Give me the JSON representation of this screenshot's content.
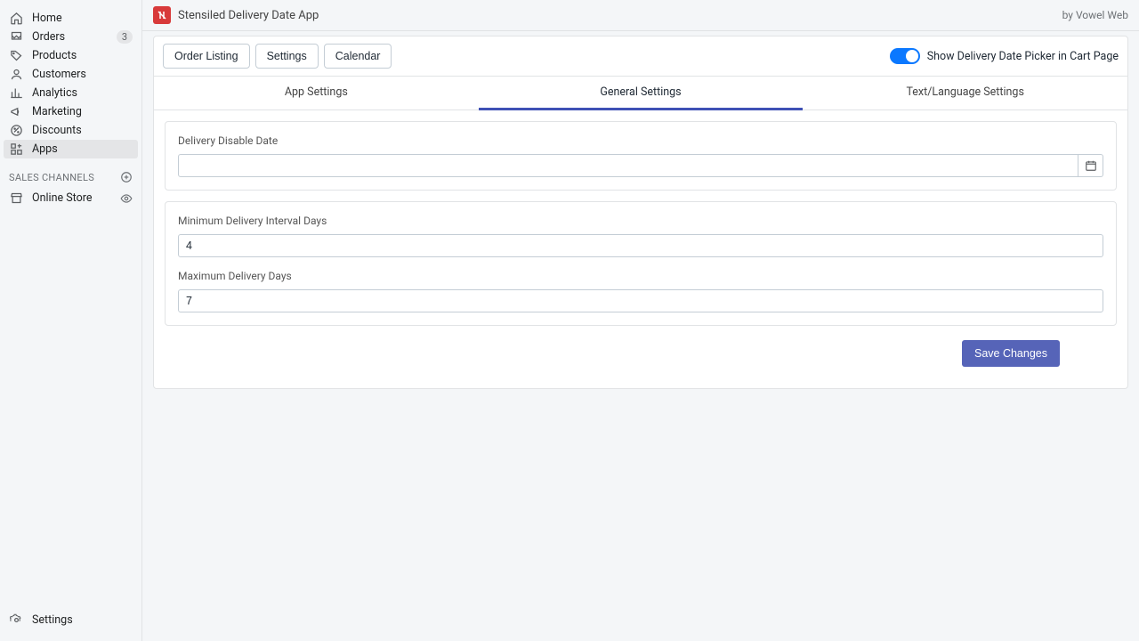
{
  "sidebar": {
    "items": [
      {
        "label": "Home"
      },
      {
        "label": "Orders",
        "badge": "3"
      },
      {
        "label": "Products"
      },
      {
        "label": "Customers"
      },
      {
        "label": "Analytics"
      },
      {
        "label": "Marketing"
      },
      {
        "label": "Discounts"
      },
      {
        "label": "Apps"
      }
    ],
    "section_title": "SALES CHANNELS",
    "channels": [
      {
        "label": "Online Store"
      }
    ],
    "bottom": {
      "label": "Settings"
    }
  },
  "header": {
    "app_title": "Stensiled Delivery Date App",
    "by_prefix": "by ",
    "by_link": "Vowel Web"
  },
  "toolbar": {
    "buttons": [
      {
        "label": "Order Listing"
      },
      {
        "label": "Settings"
      },
      {
        "label": "Calendar"
      }
    ],
    "toggle_label": "Show Delivery Date Picker in Cart Page",
    "toggle_on": true
  },
  "tabs": [
    {
      "label": "App Settings",
      "active": false
    },
    {
      "label": "General Settings",
      "active": true
    },
    {
      "label": "Text/Language Settings",
      "active": false
    }
  ],
  "form": {
    "disable_date_label": "Delivery Disable Date",
    "disable_date_value": "",
    "min_days_label": "Minimum Delivery Interval Days",
    "min_days_value": "4",
    "max_days_label": "Maximum Delivery Days",
    "max_days_value": "7",
    "save_label": "Save Changes"
  }
}
